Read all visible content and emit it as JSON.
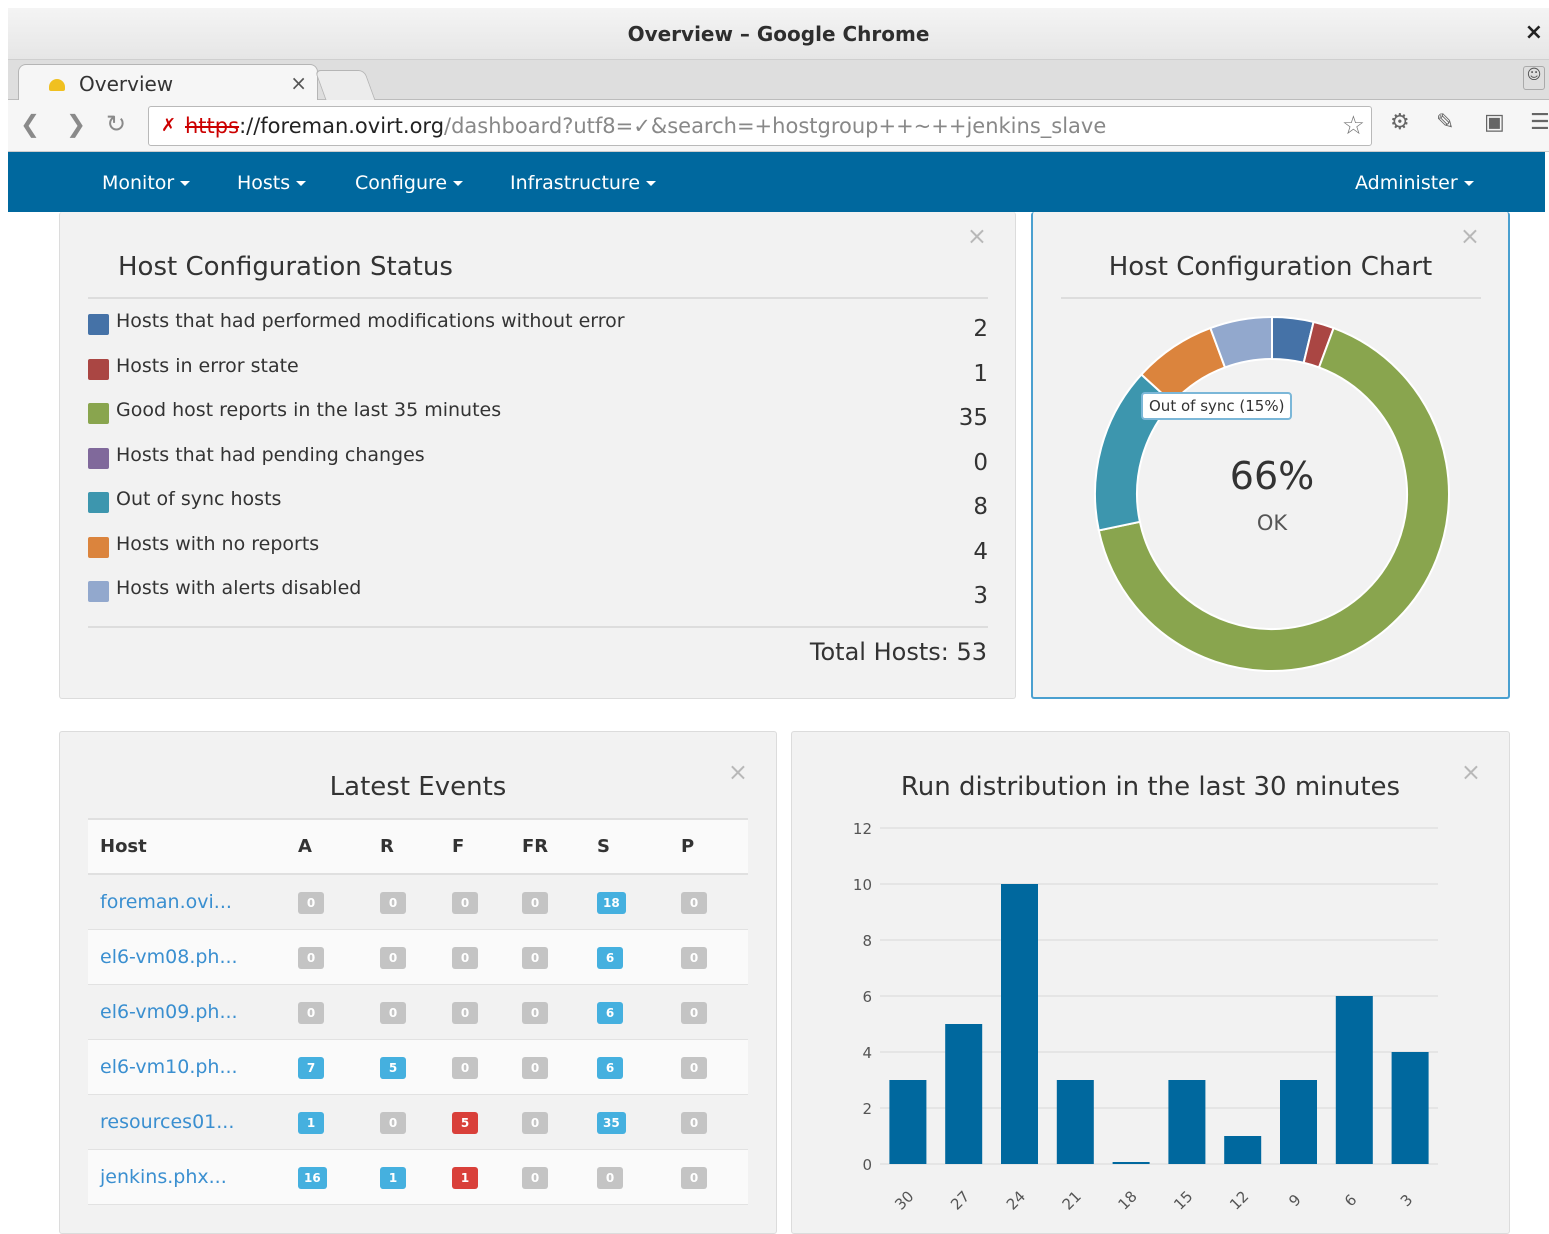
{
  "window": {
    "title": "Overview – Google Chrome",
    "close": "×"
  },
  "tab": {
    "label": "Overview",
    "close": "×"
  },
  "address": {
    "scheme": "https",
    "host": "://foreman.ovirt.org",
    "path": "/dashboard?utf8=✓&search=+hostgroup++~++jenkins_slave"
  },
  "nav": {
    "left": [
      "Monitor",
      "Hosts",
      "Configure",
      "Infrastructure"
    ],
    "right": "Administer"
  },
  "config_status": {
    "title": "Host Configuration Status",
    "rows": [
      {
        "label": "Hosts that had performed modifications without error",
        "count": "2",
        "color": "#4572a7"
      },
      {
        "label": "Hosts in error state",
        "count": "1",
        "color": "#aa4643"
      },
      {
        "label": "Good host reports in the last 35 minutes",
        "count": "35",
        "color": "#89a54e"
      },
      {
        "label": "Hosts that had pending changes",
        "count": "0",
        "color": "#80699b"
      },
      {
        "label": "Out of sync hosts",
        "count": "8",
        "color": "#3d96ae"
      },
      {
        "label": "Hosts with no reports",
        "count": "4",
        "color": "#db843d"
      },
      {
        "label": "Hosts with alerts disabled",
        "count": "3",
        "color": "#92a8cd"
      }
    ],
    "total": "Total Hosts: 53"
  },
  "config_chart": {
    "title": "Host Configuration Chart",
    "center_value": "66%",
    "center_label": "OK",
    "tooltip": "Out of sync (15%)"
  },
  "events": {
    "title": "Latest Events",
    "columns": [
      "Host",
      "A",
      "R",
      "F",
      "FR",
      "S",
      "P"
    ],
    "rows": [
      {
        "host": "foreman.ovi...",
        "vals": [
          "0",
          "0",
          "0",
          "0",
          "18",
          "0"
        ]
      },
      {
        "host": "el6-vm08.ph...",
        "vals": [
          "0",
          "0",
          "0",
          "0",
          "6",
          "0"
        ]
      },
      {
        "host": "el6-vm09.ph...",
        "vals": [
          "0",
          "0",
          "0",
          "0",
          "6",
          "0"
        ]
      },
      {
        "host": "el6-vm10.ph...",
        "vals": [
          "7",
          "5",
          "0",
          "0",
          "6",
          "0"
        ]
      },
      {
        "host": "resources01...",
        "vals": [
          "1",
          "0",
          "5",
          "0",
          "35",
          "0"
        ]
      },
      {
        "host": "jenkins.phx...",
        "vals": [
          "16",
          "1",
          "1",
          "0",
          "0",
          "0"
        ]
      }
    ]
  },
  "chart_data": [
    {
      "type": "pie",
      "title": "Host Configuration Chart",
      "categories": [
        "Hosts that had performed modifications without error",
        "Hosts in error state",
        "Good host reports in the last 35 minutes",
        "Hosts that had pending changes",
        "Out of sync hosts",
        "Hosts with no reports",
        "Hosts with alerts disabled"
      ],
      "values": [
        2,
        1,
        35,
        0,
        8,
        4,
        3
      ],
      "colors": [
        "#4572a7",
        "#aa4643",
        "#89a54e",
        "#80699b",
        "#3d96ae",
        "#db843d",
        "#92a8cd"
      ]
    },
    {
      "type": "bar",
      "title": "Run distribution in the last 30 minutes",
      "categories": [
        "30",
        "27",
        "24",
        "21",
        "18",
        "15",
        "12",
        "9",
        "6",
        "3"
      ],
      "values": [
        3,
        5,
        10,
        3,
        0,
        3,
        1,
        3,
        6,
        4
      ],
      "ylim": [
        0,
        12
      ],
      "yticks": [
        "0",
        "2",
        "4",
        "6",
        "8",
        "10",
        "12"
      ],
      "grid": true,
      "color": "#00689e"
    }
  ]
}
